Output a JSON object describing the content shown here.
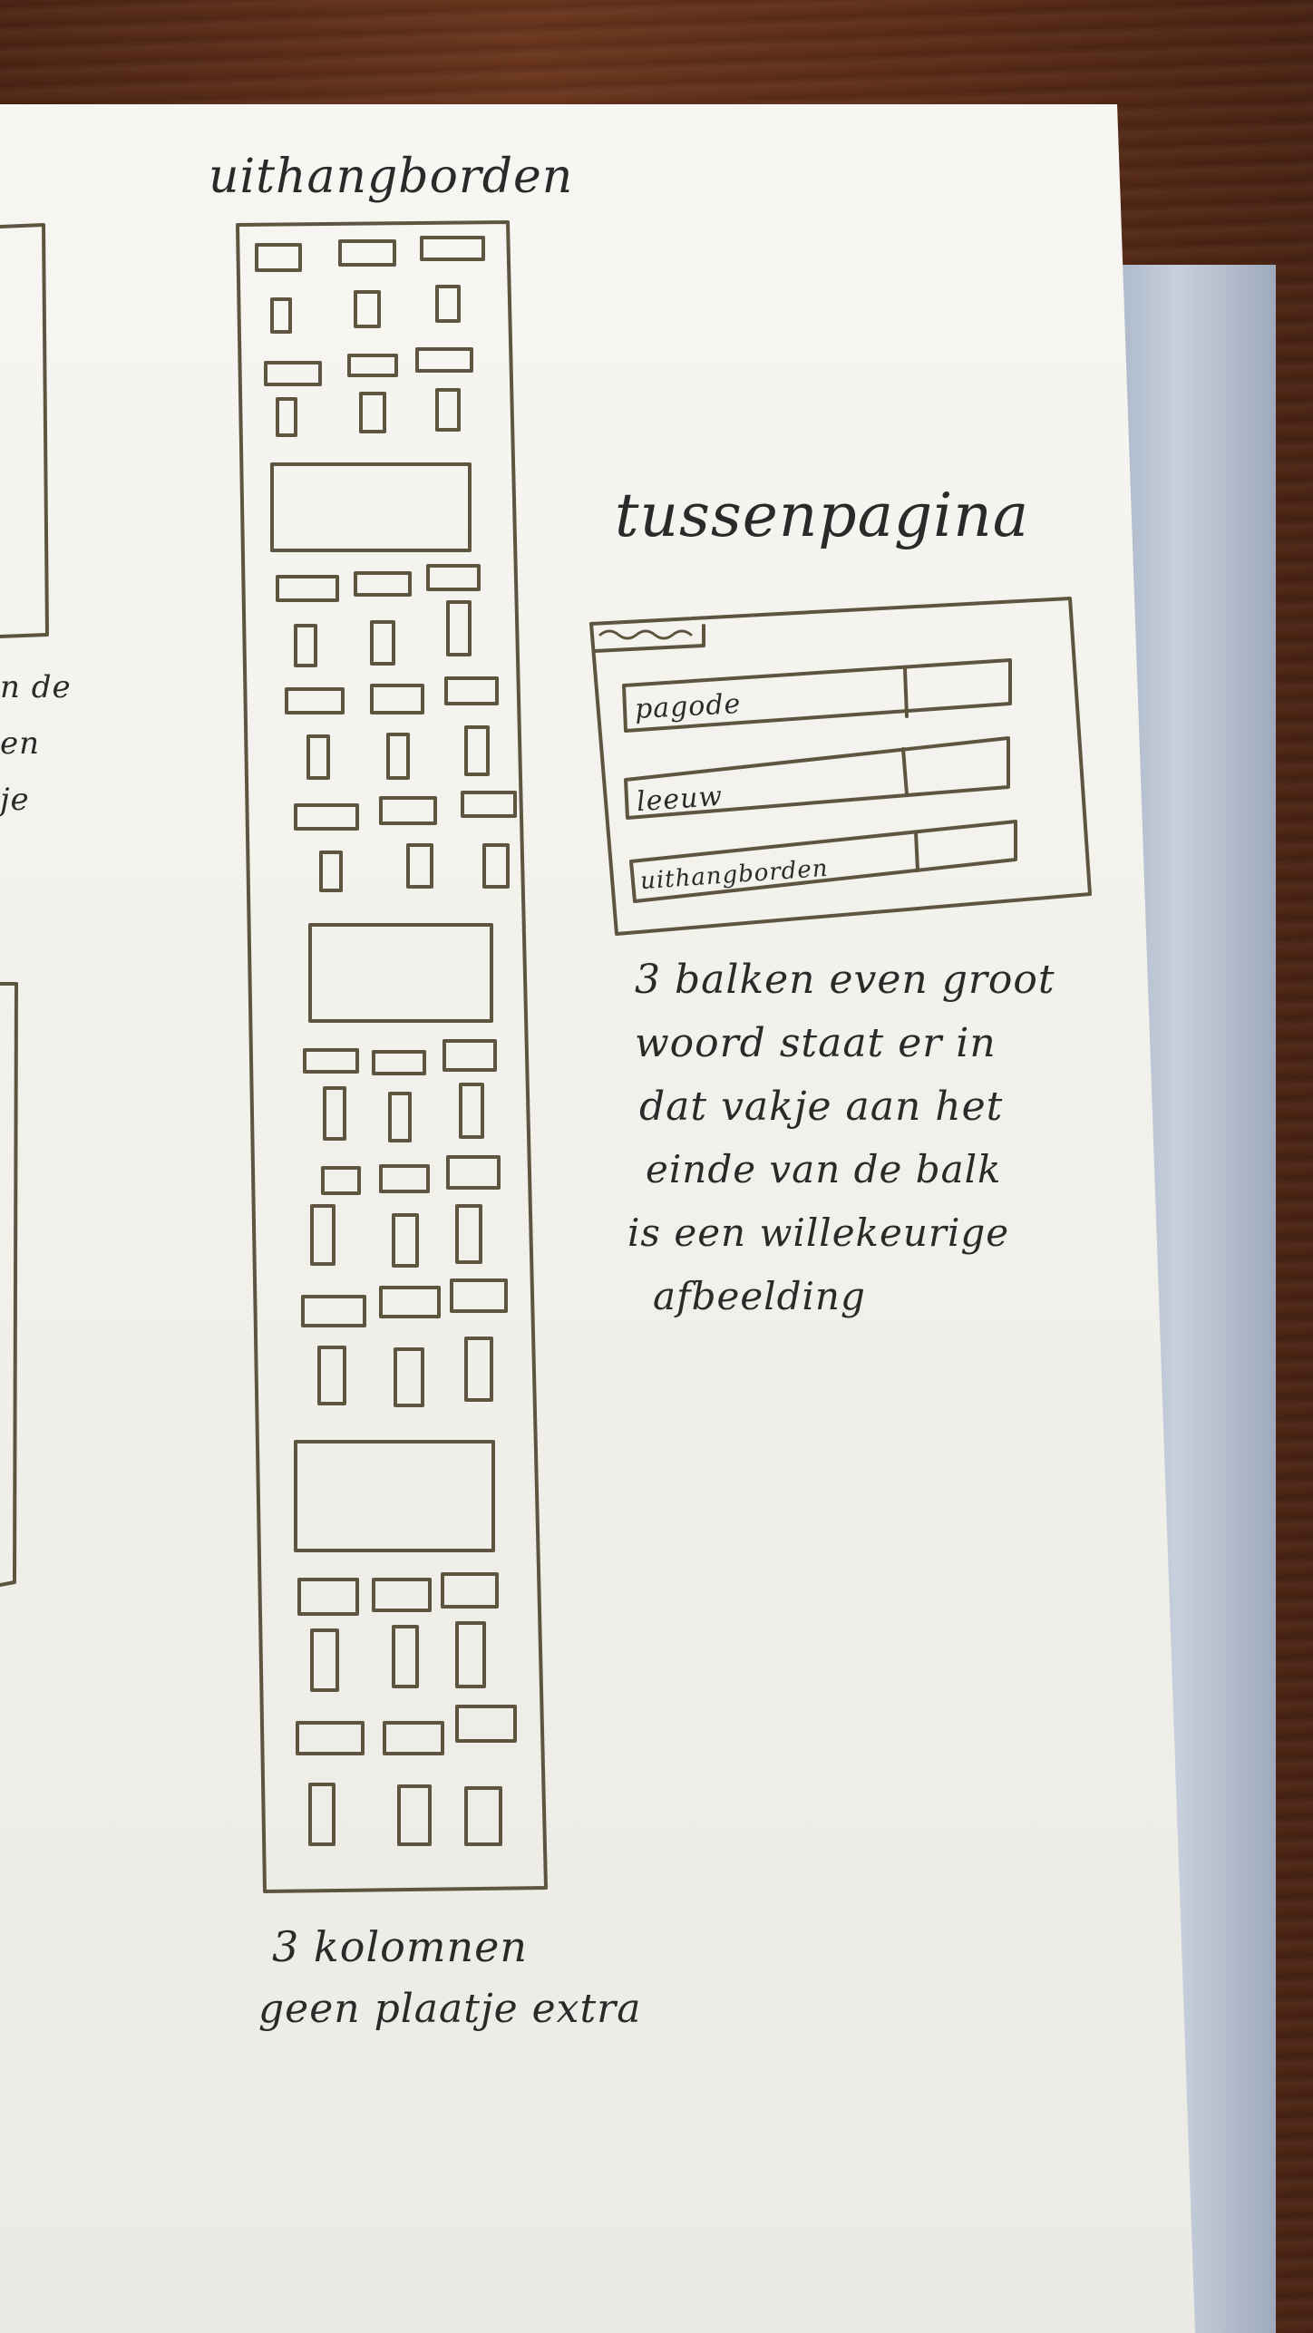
{
  "sketch": {
    "title_left": "uithangborden",
    "notes_left": "3 kolomnen",
    "notes_left_2": "geen plaatje extra",
    "title_right": "tussenpagina",
    "bars": [
      {
        "label": "pagode"
      },
      {
        "label": "leeuw"
      },
      {
        "label": "uithangborden"
      }
    ],
    "notes_right": [
      "3 balken even groot",
      "woord staat er in",
      "dat vakje aan het",
      "einde van de balk",
      "is een willekeurige",
      "afbeelding"
    ],
    "edge_notes": [
      "n de",
      "en",
      "je"
    ]
  }
}
